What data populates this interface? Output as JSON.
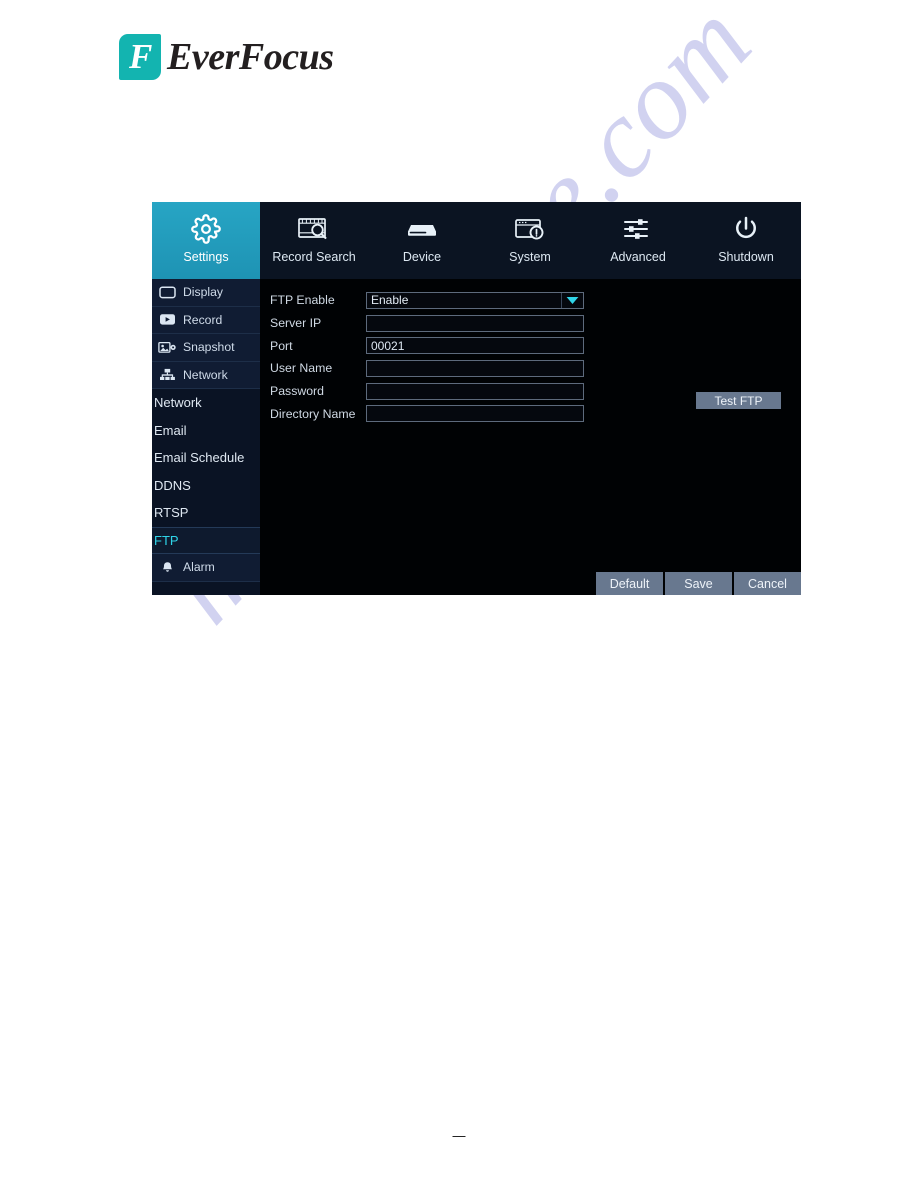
{
  "brand": {
    "logo_letter": "F",
    "logo_text": "EverFocus",
    "logo_color": "#13b4b0"
  },
  "watermark": {
    "text": "manualshive.com",
    "color": "#c9cbee"
  },
  "footer": {
    "dash": "—"
  },
  "dvr": {
    "accent_color": "#27a5c4",
    "selected_color": "#2fd4e8",
    "topnav": [
      {
        "label": "Settings",
        "icon": "gear-icon",
        "active": true
      },
      {
        "label": "Record Search",
        "icon": "film-search-icon",
        "active": false
      },
      {
        "label": "Device",
        "icon": "hard-disk-icon",
        "active": false
      },
      {
        "label": "System",
        "icon": "system-info-icon",
        "active": false
      },
      {
        "label": "Advanced",
        "icon": "sliders-icon",
        "active": false
      },
      {
        "label": "Shutdown",
        "icon": "power-icon",
        "active": false
      }
    ],
    "sidebar": [
      {
        "label": "Display",
        "icon": "monitor-icon",
        "type": "group"
      },
      {
        "label": "Record",
        "icon": "record-icon",
        "type": "group"
      },
      {
        "label": "Snapshot",
        "icon": "snapshot-icon",
        "type": "group"
      },
      {
        "label": "Network",
        "icon": "network-icon",
        "type": "group"
      },
      {
        "label": "Network",
        "icon": "",
        "type": "sub"
      },
      {
        "label": "Email",
        "icon": "",
        "type": "sub"
      },
      {
        "label": "Email Schedule",
        "icon": "",
        "type": "sub"
      },
      {
        "label": "DDNS",
        "icon": "",
        "type": "sub"
      },
      {
        "label": "RTSP",
        "icon": "",
        "type": "sub"
      },
      {
        "label": "FTP",
        "icon": "",
        "type": "sub-selected"
      },
      {
        "label": "Alarm",
        "icon": "bell-icon",
        "type": "group"
      }
    ],
    "form": {
      "fields": [
        {
          "label": "FTP Enable",
          "kind": "select",
          "value": "Enable",
          "placeholder": ""
        },
        {
          "label": "Server IP",
          "kind": "text",
          "value": "",
          "placeholder": ""
        },
        {
          "label": "Port",
          "kind": "text",
          "value": "00021",
          "placeholder": ""
        },
        {
          "label": "User Name",
          "kind": "text",
          "value": "",
          "placeholder": ""
        },
        {
          "label": "Password",
          "kind": "text",
          "value": "",
          "placeholder": ""
        },
        {
          "label": "Directory Name",
          "kind": "text",
          "value": "",
          "placeholder": ""
        }
      ],
      "test_button": "Test FTP"
    },
    "buttons": {
      "default": "Default",
      "save": "Save",
      "cancel": "Cancel"
    }
  }
}
